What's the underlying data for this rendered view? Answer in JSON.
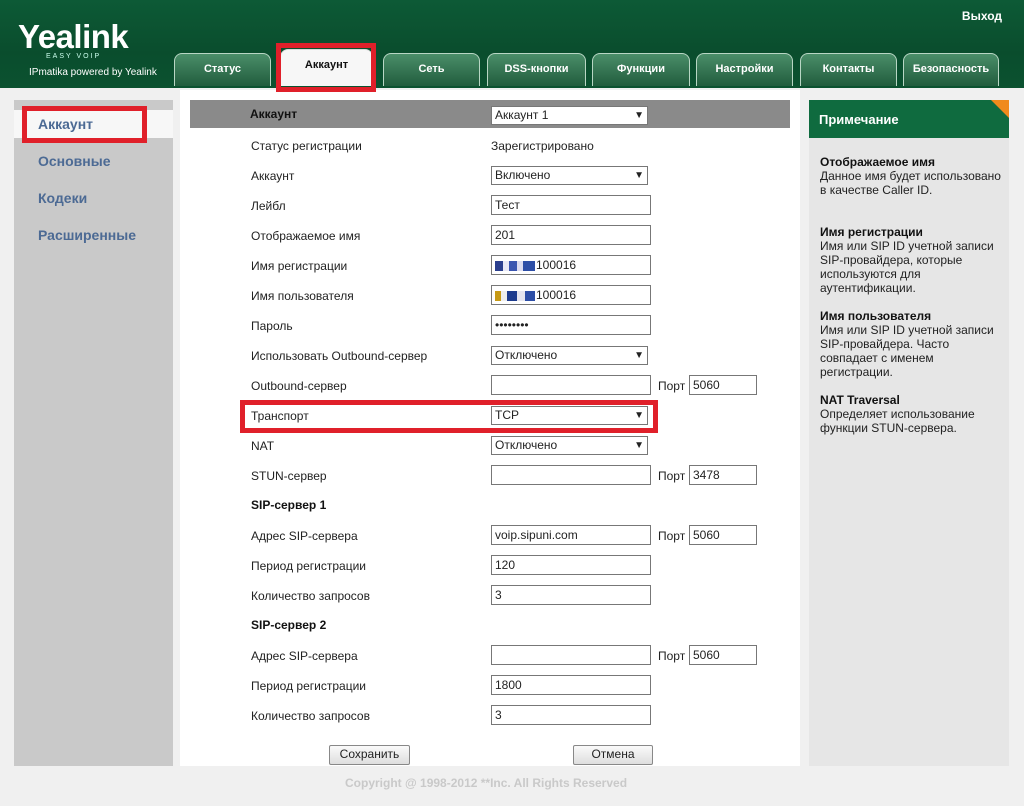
{
  "header": {
    "logo": "Yealink",
    "logo_sub": "EASY VOIP",
    "tagline": "IPmatika powered by Yealink",
    "logout": "Выход",
    "tabs": [
      "Статус",
      "Аккаунт",
      "Сеть",
      "DSS-кнопки",
      "Функции",
      "Настройки",
      "Контакты",
      "Безопасность"
    ],
    "active_tab": "Аккаунт"
  },
  "sidebar": {
    "items": [
      "Аккаунт",
      "Основные",
      "Кодеки",
      "Расширенные"
    ],
    "active": "Аккаунт"
  },
  "form": {
    "account_header": "Аккаунт",
    "account_select": "Аккаунт 1",
    "fields": {
      "reg_status": {
        "label": "Статус регистрации",
        "value": "Зарегистрировано"
      },
      "account": {
        "label": "Аккаунт",
        "value": "Включено"
      },
      "label": {
        "label": "Лейбл",
        "value": "Тест"
      },
      "display_name": {
        "label": "Отображаемое имя",
        "value": "201"
      },
      "reg_name": {
        "label": "Имя регистрации",
        "value": "100016"
      },
      "user_name": {
        "label": "Имя пользователя",
        "value": "100016"
      },
      "password": {
        "label": "Пароль",
        "value": "••••••••"
      },
      "use_outbound": {
        "label": "Использовать Outbound-сервер",
        "value": "Отключено"
      },
      "outbound": {
        "label": "Outbound-сервер",
        "value": "",
        "port_label": "Порт",
        "port": "5060"
      },
      "transport": {
        "label": "Транспорт",
        "value": "TCP"
      },
      "nat": {
        "label": "NAT",
        "value": "Отключено"
      },
      "stun": {
        "label": "STUN-сервер",
        "value": "",
        "port_label": "Порт",
        "port": "3478"
      }
    },
    "sip1": {
      "title": "SIP-сервер 1",
      "address_label": "Адрес SIP-сервера",
      "address": "voip.sipuni.com",
      "port_label": "Порт",
      "port": "5060",
      "period_label": "Период регистрации",
      "period": "120",
      "retries_label": "Количество запросов",
      "retries": "3"
    },
    "sip2": {
      "title": "SIP-сервер 2",
      "address_label": "Адрес SIP-сервера",
      "address": "",
      "port_label": "Порт",
      "port": "5060",
      "period_label": "Период регистрации",
      "period": "1800",
      "retries_label": "Количество запросов",
      "retries": "3"
    },
    "save": "Сохранить",
    "cancel": "Отмена"
  },
  "notes": {
    "title": "Примечание",
    "items": [
      {
        "title": "Отображаемое имя",
        "text": "Данное имя будет использовано в качестве Caller ID."
      },
      {
        "title": "Имя регистрации",
        "text": "Имя или SIP ID учетной записи SIP-провайдера, которые используются для аутентификации."
      },
      {
        "title": "Имя пользователя",
        "text": "Имя или SIP ID учетной записи SIP-провайдера. Часто совпадает с именем регистрации."
      },
      {
        "title": "NAT Traversal",
        "text": "Определяет использование функции STUN-сервера."
      }
    ]
  },
  "footer": "Copyright @ 1998-2012 **Inc. All Rights Reserved",
  "colors": {
    "header_green": "#0d5a36",
    "highlight_red": "#e0202a",
    "nav_text": "#4c6a94",
    "corner_orange": "#f08a1c"
  }
}
